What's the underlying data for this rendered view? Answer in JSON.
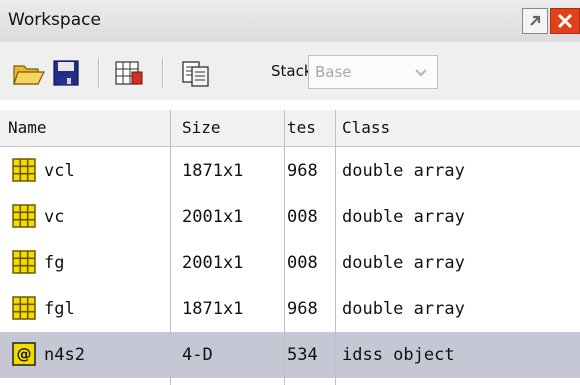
{
  "window": {
    "title": "Workspace"
  },
  "toolbar": {
    "icons": [
      "open-folder-icon",
      "save-icon",
      "import-data-icon",
      "copy-icon"
    ],
    "stack_label": "Stack:",
    "stack_value": "Base"
  },
  "table": {
    "headers": {
      "name": "Name",
      "size": "Size",
      "bytes": "tes",
      "class": "Class"
    },
    "rows": [
      {
        "name": "vcl",
        "size": "1871x1",
        "bytes": "968",
        "class": "double array",
        "icon": "matrix-icon",
        "selected": false
      },
      {
        "name": "vc",
        "size": "2001x1",
        "bytes": "008",
        "class": "double array",
        "icon": "matrix-icon",
        "selected": false
      },
      {
        "name": "fg",
        "size": "2001x1",
        "bytes": "008",
        "class": "double array",
        "icon": "matrix-icon",
        "selected": false
      },
      {
        "name": "fgl",
        "size": "1871x1",
        "bytes": "968",
        "class": "double array",
        "icon": "matrix-icon",
        "selected": false
      },
      {
        "name": "n4s2",
        "size": "4-D",
        "bytes": "534",
        "class": "idss object",
        "icon": "object-icon",
        "selected": true
      }
    ]
  },
  "colors": {
    "selection": "#c5c8d4",
    "matrix_icon": "#f5dc00",
    "close": "#e0411b"
  }
}
